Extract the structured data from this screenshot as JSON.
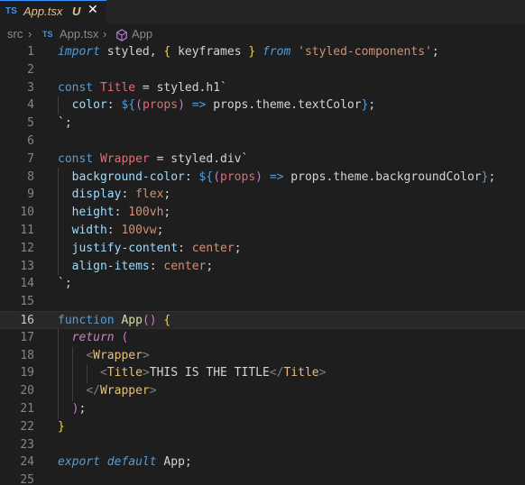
{
  "tab": {
    "lang_badge": "TS",
    "filename": "App.tsx",
    "modified": "U",
    "close_glyph": "✕"
  },
  "breadcrumb": {
    "folder": "src",
    "chevron": "›",
    "lang_badge": "TS",
    "file": "App.tsx",
    "symbol_glyph": "⬡",
    "symbol": "App"
  },
  "lines": [
    {
      "n": "1",
      "tokens": [
        [
          "kwi",
          "import"
        ],
        [
          "punc",
          " styled, "
        ],
        [
          "br1",
          "{"
        ],
        [
          "punc",
          " keyframes "
        ],
        [
          "br1",
          "}"
        ],
        [
          "punc",
          " "
        ],
        [
          "kwi",
          "from"
        ],
        [
          "punc",
          " "
        ],
        [
          "str",
          "'styled-components'"
        ],
        [
          "punc",
          ";"
        ]
      ]
    },
    {
      "n": "2",
      "tokens": []
    },
    {
      "n": "3",
      "tokens": [
        [
          "kw",
          "const"
        ],
        [
          "punc",
          " "
        ],
        [
          "var",
          "Title"
        ],
        [
          "punc",
          " = styled.h1"
        ],
        [
          "tpl",
          "`"
        ]
      ]
    },
    {
      "n": "4",
      "tokens": [
        [
          "punc",
          "  "
        ],
        [
          "prop",
          "color"
        ],
        [
          "punc",
          ": "
        ],
        [
          "kw",
          "${"
        ],
        [
          "br2",
          "("
        ],
        [
          "var",
          "props"
        ],
        [
          "br2",
          ")"
        ],
        [
          "punc",
          " "
        ],
        [
          "kw",
          "=>"
        ],
        [
          "punc",
          " props.theme.textColor"
        ],
        [
          "kw",
          "}"
        ],
        [
          "punc",
          ";"
        ]
      ]
    },
    {
      "n": "5",
      "tokens": [
        [
          "tpl",
          "`"
        ],
        [
          "punc",
          ";"
        ]
      ]
    },
    {
      "n": "6",
      "tokens": []
    },
    {
      "n": "7",
      "tokens": [
        [
          "kw",
          "const"
        ],
        [
          "punc",
          " "
        ],
        [
          "var",
          "Wrapper"
        ],
        [
          "punc",
          " = styled.div"
        ],
        [
          "tpl",
          "`"
        ]
      ]
    },
    {
      "n": "8",
      "tokens": [
        [
          "punc",
          "  "
        ],
        [
          "prop",
          "background-color"
        ],
        [
          "punc",
          ": "
        ],
        [
          "kw",
          "${"
        ],
        [
          "br2",
          "("
        ],
        [
          "var",
          "props"
        ],
        [
          "br2",
          ")"
        ],
        [
          "punc",
          " "
        ],
        [
          "kw",
          "=>"
        ],
        [
          "punc",
          " props.theme.backgroundColor"
        ],
        [
          "kw",
          "}"
        ],
        [
          "punc",
          ";"
        ]
      ]
    },
    {
      "n": "9",
      "tokens": [
        [
          "punc",
          "  "
        ],
        [
          "prop",
          "display"
        ],
        [
          "punc",
          ": "
        ],
        [
          "cssval",
          "flex"
        ],
        [
          "punc",
          ";"
        ]
      ]
    },
    {
      "n": "10",
      "tokens": [
        [
          "punc",
          "  "
        ],
        [
          "prop",
          "height"
        ],
        [
          "punc",
          ": "
        ],
        [
          "cssval",
          "100vh"
        ],
        [
          "punc",
          ";"
        ]
      ]
    },
    {
      "n": "11",
      "tokens": [
        [
          "punc",
          "  "
        ],
        [
          "prop",
          "width"
        ],
        [
          "punc",
          ": "
        ],
        [
          "cssval",
          "100vw"
        ],
        [
          "punc",
          ";"
        ]
      ]
    },
    {
      "n": "12",
      "tokens": [
        [
          "punc",
          "  "
        ],
        [
          "prop",
          "justify-content"
        ],
        [
          "punc",
          ": "
        ],
        [
          "cssval",
          "center"
        ],
        [
          "punc",
          ";"
        ]
      ]
    },
    {
      "n": "13",
      "tokens": [
        [
          "punc",
          "  "
        ],
        [
          "prop",
          "align-items"
        ],
        [
          "punc",
          ": "
        ],
        [
          "cssval",
          "center"
        ],
        [
          "punc",
          ";"
        ]
      ]
    },
    {
      "n": "14",
      "tokens": [
        [
          "tpl",
          "`"
        ],
        [
          "punc",
          ";"
        ]
      ]
    },
    {
      "n": "15",
      "tokens": []
    },
    {
      "n": "16",
      "tokens": [
        [
          "kw",
          "function"
        ],
        [
          "punc",
          " "
        ],
        [
          "fn",
          "App"
        ],
        [
          "br2",
          "()"
        ],
        [
          "punc",
          " "
        ],
        [
          "br1",
          "{"
        ]
      ],
      "current": true
    },
    {
      "n": "17",
      "tokens": [
        [
          "punc",
          "  "
        ],
        [
          "ctl",
          "return"
        ],
        [
          "punc",
          " "
        ],
        [
          "br2",
          "("
        ]
      ]
    },
    {
      "n": "18",
      "tokens": [
        [
          "punc",
          "    "
        ],
        [
          "lt",
          "<"
        ],
        [
          "tag",
          "Wrapper"
        ],
        [
          "lt",
          ">"
        ]
      ]
    },
    {
      "n": "19",
      "tokens": [
        [
          "punc",
          "      "
        ],
        [
          "lt",
          "<"
        ],
        [
          "tag",
          "Title"
        ],
        [
          "lt",
          ">"
        ],
        [
          "text",
          "THIS IS THE TITLE"
        ],
        [
          "lt",
          "</"
        ],
        [
          "tag",
          "Title"
        ],
        [
          "lt",
          ">"
        ]
      ]
    },
    {
      "n": "20",
      "tokens": [
        [
          "punc",
          "    "
        ],
        [
          "lt",
          "</"
        ],
        [
          "tag",
          "Wrapper"
        ],
        [
          "lt",
          ">"
        ]
      ]
    },
    {
      "n": "21",
      "tokens": [
        [
          "punc",
          "  "
        ],
        [
          "br2",
          ")"
        ],
        [
          "punc",
          ";"
        ]
      ]
    },
    {
      "n": "22",
      "tokens": [
        [
          "br1",
          "}"
        ]
      ]
    },
    {
      "n": "23",
      "tokens": []
    },
    {
      "n": "24",
      "tokens": [
        [
          "kwi",
          "export"
        ],
        [
          "punc",
          " "
        ],
        [
          "kwi",
          "default"
        ],
        [
          "punc",
          " App;"
        ]
      ]
    },
    {
      "n": "25",
      "tokens": []
    }
  ]
}
